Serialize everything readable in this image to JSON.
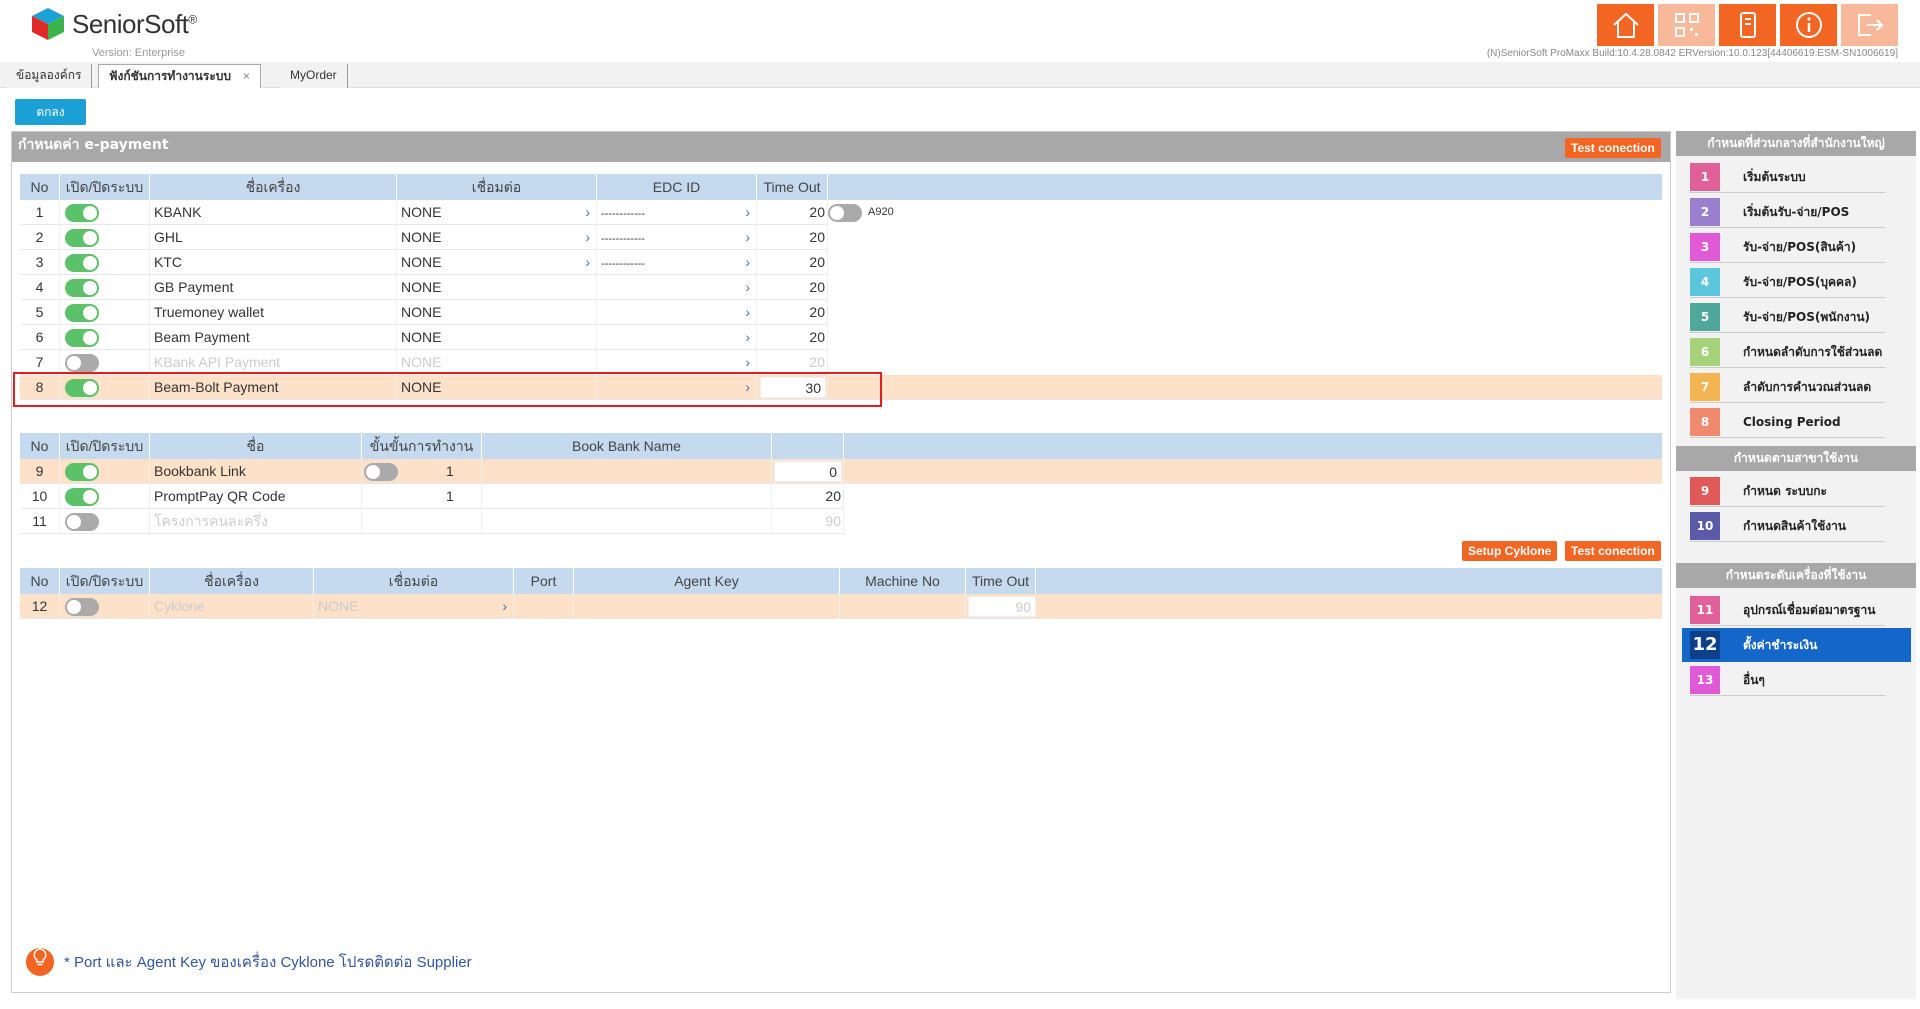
{
  "header": {
    "brand": "SeniorSoft",
    "brand_mark": "®",
    "version": "Version: Enterprise",
    "build": "(N)SeniorSoft ProMaxx Build:10.4.28.0842 ERVersion:10.0.123[44406619:ESM-SN1006619]",
    "icons": [
      "home-icon",
      "qr-code-icon",
      "phone-icon",
      "info-icon",
      "logout-icon"
    ],
    "accent_color": "#f26522"
  },
  "tabs": [
    {
      "label": "ข้อมูลองค์กร"
    },
    {
      "label": "ฟังก์ชันการทำงานระบบ",
      "close": "×"
    },
    {
      "label": "MyOrder"
    }
  ],
  "ok_button": "ตกลง",
  "panel": {
    "title": "กำหนดค่า e-payment",
    "test_connection": "Test conection",
    "setup_cyklone": "Setup Cyklone"
  },
  "table1": {
    "headers": [
      "No",
      "เปิด/ปิดระบบ",
      "ชื่อเครื่อง",
      "เชื่อมต่อ",
      "EDC ID",
      "Time Out"
    ],
    "rows": [
      {
        "no": "1",
        "on": true,
        "name": "KBANK",
        "connect": "NONE",
        "edc": "------------",
        "timeout": "20",
        "extra_label": "A920",
        "extra_on": false
      },
      {
        "no": "2",
        "on": true,
        "name": "GHL",
        "connect": "NONE",
        "edc": "------------",
        "timeout": "20"
      },
      {
        "no": "3",
        "on": true,
        "name": "KTC",
        "connect": "NONE",
        "edc": "------------",
        "timeout": "20"
      },
      {
        "no": "4",
        "on": true,
        "name": "GB Payment",
        "connect": "NONE",
        "edc": "",
        "timeout": "20"
      },
      {
        "no": "5",
        "on": true,
        "name": "Truemoney wallet",
        "connect": "NONE",
        "edc": "",
        "timeout": "20"
      },
      {
        "no": "6",
        "on": true,
        "name": "Beam Payment",
        "connect": "NONE",
        "edc": "",
        "timeout": "20"
      },
      {
        "no": "7",
        "on": false,
        "name": "KBank API Payment",
        "connect": "NONE",
        "edc": "",
        "timeout": "20"
      },
      {
        "no": "8",
        "on": true,
        "name": "Beam-Bolt Payment",
        "connect": "NONE",
        "edc": "",
        "timeout": "30"
      }
    ]
  },
  "table2": {
    "headers": [
      "No",
      "เปิด/ปิดระบบ",
      "ชื่อ",
      "ขั้นขั้นการทำงาน",
      "Book Bank Name",
      ""
    ],
    "rows": [
      {
        "no": "9",
        "on": true,
        "name": "Bookbank Link",
        "step": "1",
        "step_toggle": false,
        "timeout": "0"
      },
      {
        "no": "10",
        "on": true,
        "name": "PromptPay QR Code",
        "step": "1",
        "timeout": "20"
      },
      {
        "no": "11",
        "on": false,
        "name": "โครงการคนละครึ่ง",
        "step": "",
        "timeout": "90"
      }
    ]
  },
  "table3": {
    "headers": [
      "No",
      "เปิด/ปิดระบบ",
      "ชื่อเครื่อง",
      "เชื่อมต่อ",
      "Port",
      "Agent Key",
      "Machine No",
      "Time Out"
    ],
    "rows": [
      {
        "no": "12",
        "on": false,
        "name": "Cyklone",
        "connect": "NONE",
        "timeout": "90"
      }
    ]
  },
  "note": "* Port และ Agent Key ของเครื่อง Cyklone  โปรดติดต่อ Supplier",
  "sidebar": {
    "sections": [
      "กำหนดที่ส่วนกลางที่สำนักงานใหญ่",
      "กำหนดตามสาขาใช้งาน",
      "กำหนดระดับเครื่องที่ใช้งาน"
    ],
    "items": [
      {
        "num": "1",
        "label": "เริ่มต้นระบบ",
        "color": "#e0609a"
      },
      {
        "num": "2",
        "label": "เริ่มต้นรับ-จ่าย/POS",
        "color": "#9a7fcf"
      },
      {
        "num": "3",
        "label": "รับ-จ่าย/POS(สินค้า)",
        "color": "#e05ad8"
      },
      {
        "num": "4",
        "label": "รับ-จ่าย/POS(บุคคล)",
        "color": "#5cc6dc"
      },
      {
        "num": "5",
        "label": "รับ-จ่าย/POS(พนักงาน)",
        "color": "#4fa89a"
      },
      {
        "num": "6",
        "label": "กำหนดลำดับการใช้ส่วนลด",
        "color": "#a6d27a"
      },
      {
        "num": "7",
        "label": "ลำดับการคำนวณส่วนลด",
        "color": "#f3b552"
      },
      {
        "num": "8",
        "label": "Closing Period",
        "color": "#f08a6e"
      },
      {
        "num": "9",
        "label": "กำหนด ระบบกะ",
        "color": "#e05858"
      },
      {
        "num": "10",
        "label": "กำหนดสินค้าใช้งาน",
        "color": "#5a5aa8"
      },
      {
        "num": "11",
        "label": "อุปกรณ์เชื่อมต่อมาตรฐาน",
        "color": "#e0609a"
      },
      {
        "num": "12",
        "label": "ตั้งค่าชำระเงิน",
        "color": "#0e3f8a"
      },
      {
        "num": "13",
        "label": "อื่นๆ",
        "color": "#e05ad8"
      }
    ]
  }
}
